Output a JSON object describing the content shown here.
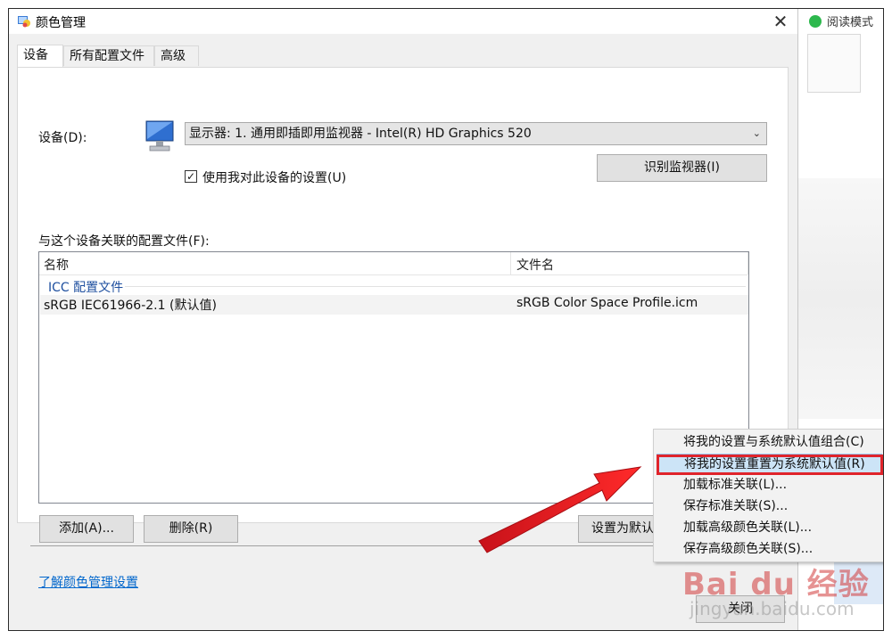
{
  "window": {
    "title": "颜色管理",
    "close_symbol": "✕"
  },
  "tabs": [
    {
      "label": "设备",
      "active": true
    },
    {
      "label": "所有配置文件",
      "active": false
    },
    {
      "label": "高级",
      "active": false
    }
  ],
  "device": {
    "label": "设备(D):",
    "selected": "显示器: 1. 通用即插即用监视器 - Intel(R) HD Graphics 520",
    "use_settings_checkbox": {
      "label": "使用我对此设备的设置(U)",
      "checked": true,
      "mark": "✓"
    },
    "identify_button": "识别监视器(I)"
  },
  "profiles": {
    "label": "与这个设备关联的配置文件(F):",
    "columns": [
      "名称",
      "文件名"
    ],
    "group_title": "ICC 配置文件",
    "rows": [
      {
        "name": "sRGB IEC61966-2.1 (默认值)",
        "file": "sRGB Color Space Profile.icm"
      }
    ]
  },
  "buttons": {
    "add": "添加(A)...",
    "remove": "删除(R)",
    "set_default": "设置为默认"
  },
  "link": "了解颜色管理设置",
  "bottom_button": "关闭",
  "context_menu": {
    "items": [
      "将我的设置与系统默认值组合(C)",
      "将我的设置重置为系统默认值(R)",
      "加载标准关联(L)...",
      "保存标准关联(S)...",
      "加载高级颜色关联(L)...",
      "保存高级颜色关联(S)..."
    ],
    "highlighted_index": 1
  },
  "background_app": {
    "read_mode_label": "阅读模式"
  },
  "watermark": {
    "main": "Bai du 经验",
    "sub": "jingyan.baidu.com"
  },
  "colors": {
    "annotation_red": "#e0242b",
    "highlight": "#cce4f7",
    "link": "#0066cc"
  }
}
